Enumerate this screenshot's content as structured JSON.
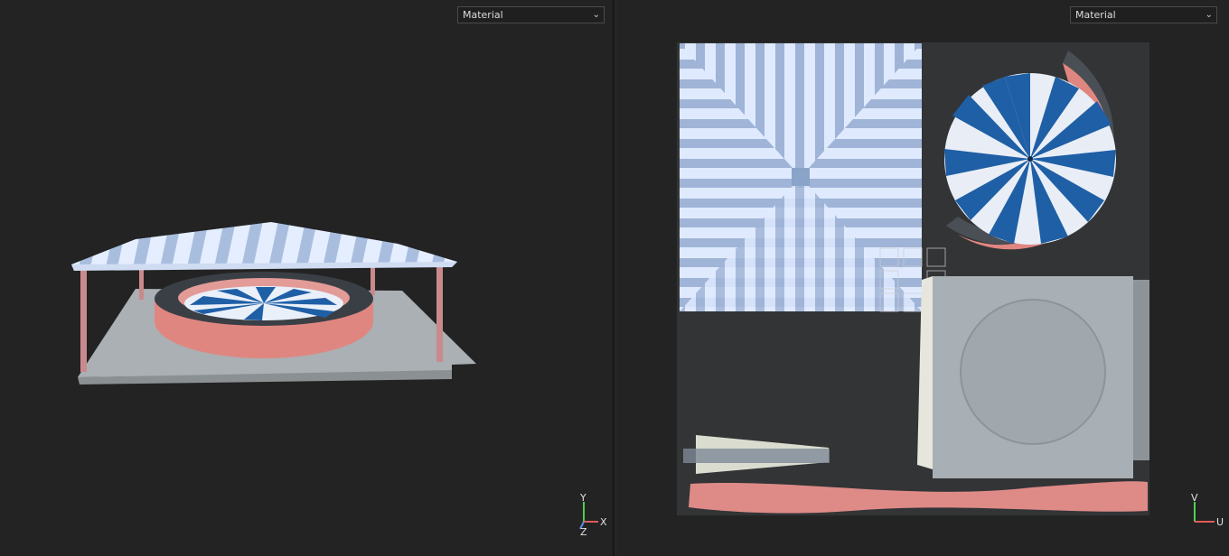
{
  "left_viewport": {
    "shading_mode": "Material",
    "axes": {
      "y": "Y",
      "x": "X",
      "z": "Z"
    }
  },
  "right_viewport": {
    "shading_mode": "Material",
    "axes": {
      "v": "V",
      "u": "U"
    }
  },
  "colors": {
    "background": "#232323",
    "stripe_light": "#d6e6ff",
    "stripe_blue": "#1f5fa6",
    "stripe_mid": "#9fb4d4",
    "wall_pink": "#e48b86",
    "rim_dark": "#3a3f45",
    "floor_grey": "#aeb3b6",
    "axis_green": "#4fd04f",
    "axis_red": "#e05a5a"
  },
  "icons": [
    "chevron-down-icon",
    "axis-gizmo-icon",
    "uv-axis-gizmo-icon"
  ]
}
